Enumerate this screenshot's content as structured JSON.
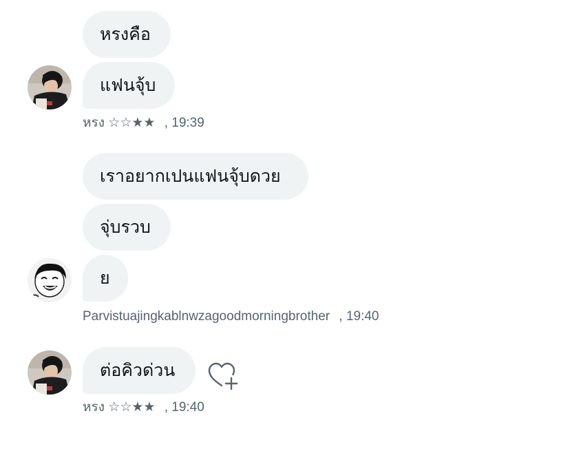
{
  "groups": [
    {
      "sender_name": "หรง ☆☆★★",
      "time": "19:39",
      "messages": [
        "หรงคือ",
        "แฟนจุ้บ"
      ]
    },
    {
      "sender_name": "Parvistuajingkablnwzagoodmorningbrother",
      "time": "19:40",
      "messages": [
        "เราอยากเปนแฟนจุ้บดวย",
        "จุ่บรวบ",
        "ย"
      ]
    },
    {
      "sender_name": "หรง ☆☆★★",
      "time": "19:40",
      "messages": [
        "ต่อคิวด่วน"
      ]
    }
  ],
  "time_separator": ",",
  "icons": {
    "reaction": "heart-plus-icon"
  },
  "colors": {
    "bubble_bg": "#eff3f4",
    "meta_text": "#536471",
    "text": "#0f1419"
  }
}
